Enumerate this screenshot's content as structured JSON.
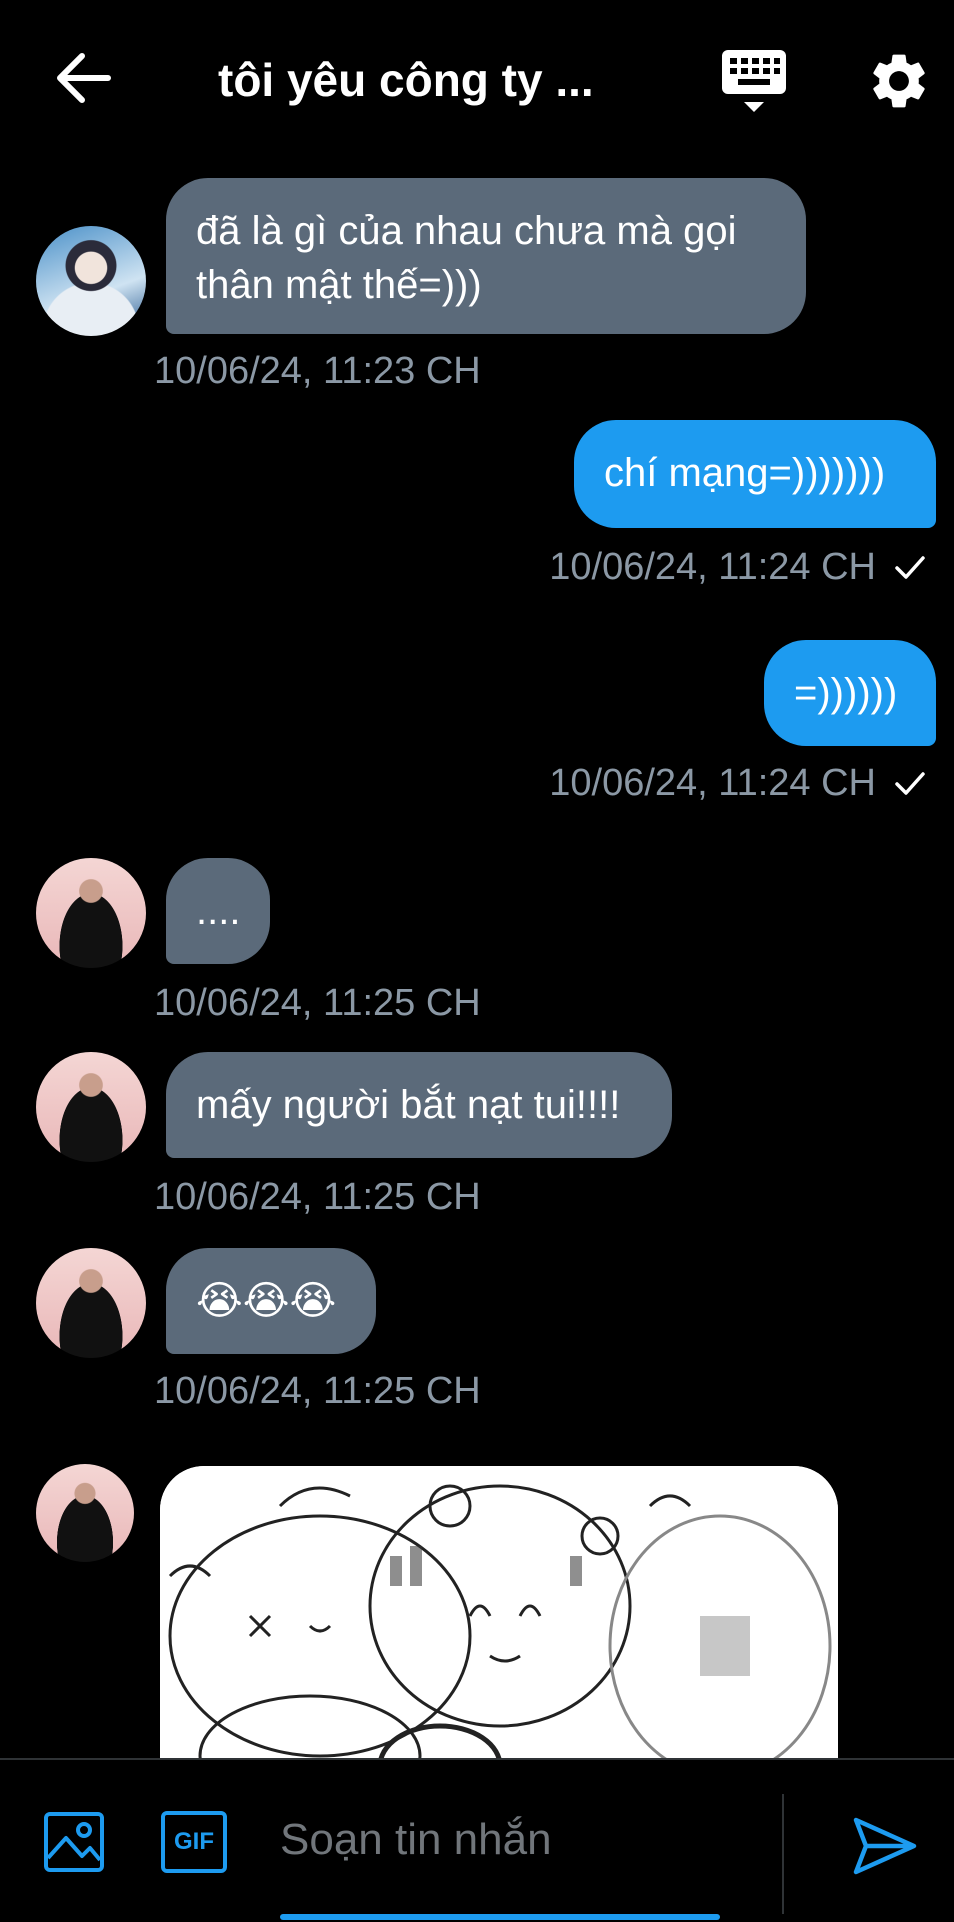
{
  "header": {
    "title": "tôi yêu công ty ...",
    "back_icon": "arrow-left-icon",
    "keyboard_icon": "keyboard-icon",
    "settings_icon": "gear-icon"
  },
  "messages": [
    {
      "direction": "in",
      "text_line1": "đã là gì của nhau chưa mà gọi",
      "text_line2": "thân mật thế=)))",
      "timestamp": "10/06/24, 11:23 CH"
    },
    {
      "direction": "out",
      "text": "chí mạng=)))))))",
      "timestamp": "10/06/24, 11:24 CH"
    },
    {
      "direction": "out",
      "text": "=))))))",
      "timestamp": "10/06/24, 11:24 CH"
    },
    {
      "direction": "in",
      "text": "....",
      "timestamp": "10/06/24, 11:25 CH"
    },
    {
      "direction": "in",
      "text": "mấy người bắt nạt tui!!!!",
      "timestamp": "10/06/24, 11:25 CH"
    },
    {
      "direction": "in",
      "text": "😭😭😭",
      "timestamp": "10/06/24, 11:25 CH"
    },
    {
      "direction": "in",
      "type": "image"
    }
  ],
  "composer": {
    "placeholder": "Soạn tin nhắn",
    "media_icon": "image-icon",
    "gif_label": "GIF",
    "send_icon": "send-icon"
  },
  "colors": {
    "background": "#000000",
    "incoming_bubble": "#5b6a7a",
    "outgoing_bubble": "#1d9bf0",
    "timestamp": "#8b98a5",
    "accent": "#1d9bf0"
  }
}
